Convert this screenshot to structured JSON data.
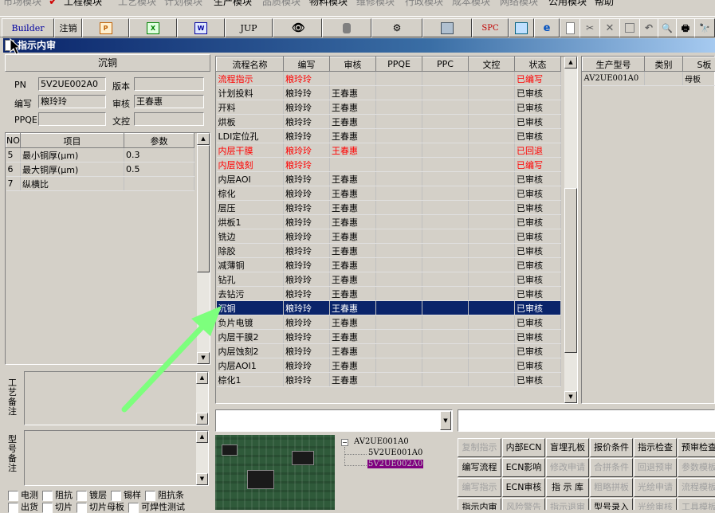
{
  "menu": {
    "items": [
      {
        "label": "市场模块",
        "active": false
      },
      {
        "label": "工程模块",
        "active": true
      },
      {
        "label": "工艺模块",
        "active": false
      },
      {
        "label": "计划模块",
        "active": false
      },
      {
        "label": "生产模块",
        "active": true
      },
      {
        "label": "品质模块",
        "active": false
      },
      {
        "label": "物料模块",
        "active": true
      },
      {
        "label": "维修模块",
        "active": false
      },
      {
        "label": "行政模块",
        "active": false
      },
      {
        "label": "成本模块",
        "active": false
      },
      {
        "label": "网络模块",
        "active": false
      },
      {
        "label": "公用模块",
        "active": true
      },
      {
        "label": "帮助",
        "active": true
      }
    ]
  },
  "toolbar": {
    "builder": "Builder",
    "logout": "注销",
    "jup": "JUP",
    "spc": "SPC",
    "icons": [
      "ppt-icon",
      "excel-icon",
      "word-icon",
      "eye-icon",
      "database-icon",
      "process-icon",
      "printer-device-icon",
      "copy-icon",
      "ie-icon",
      "new-doc-icon",
      "cut-icon",
      "delete-icon",
      "save-icon",
      "undo-icon",
      "preview-icon",
      "print-icon",
      "find-icon"
    ]
  },
  "window": {
    "title": "指示内审"
  },
  "left": {
    "header": "沉铜",
    "pn_label": "PN",
    "pn_value": "5V2UE002A0",
    "version_label": "版本",
    "version_value": "",
    "author_label": "编写",
    "author_value": "粮玲玲",
    "review_label": "审核",
    "review_value": "王春惠",
    "ppqe_label": "PPQE",
    "ppqe_value": "",
    "wenkong_label": "文控",
    "wenkong_value": "",
    "params_headers": {
      "no": "NO",
      "item": "项目",
      "value": "参数"
    },
    "params": [
      {
        "no": "5",
        "item": "最小铜厚(μm)",
        "value": "0.3"
      },
      {
        "no": "6",
        "item": "最大铜厚(μm)",
        "value": "0.5"
      },
      {
        "no": "7",
        "item": "纵横比",
        "value": ""
      }
    ],
    "process_note_label": "工艺备注",
    "model_note_label": "型号备注",
    "checkboxes_row1": [
      "电测",
      "阻抗",
      "镀层",
      "锡样",
      "阻抗条"
    ],
    "checkboxes_row2": [
      "出货",
      "切片",
      "切片母板",
      "可焊性测试"
    ]
  },
  "flow": {
    "headers": {
      "name": "流程名称",
      "author": "编写",
      "review": "审核",
      "ppqe": "PPQE",
      "ppc": "PPC",
      "wenkong": "文控",
      "status": "状态"
    },
    "rows": [
      {
        "name": "流程指示",
        "author": "粮玲玲",
        "review": "",
        "status": "已编写",
        "red": true
      },
      {
        "name": "计划投料",
        "author": "粮玲玲",
        "review": "王春惠",
        "status": "已审核",
        "red": false
      },
      {
        "name": "开料",
        "author": "粮玲玲",
        "review": "王春惠",
        "status": "已审核",
        "red": false
      },
      {
        "name": "烘板",
        "author": "粮玲玲",
        "review": "王春惠",
        "status": "已审核",
        "red": false
      },
      {
        "name": "LDI定位孔",
        "author": "粮玲玲",
        "review": "王春惠",
        "status": "已审核",
        "red": false
      },
      {
        "name": "内层干膜",
        "author": "粮玲玲",
        "review": "王春惠",
        "status": "已回退",
        "red": true
      },
      {
        "name": "内层蚀刻",
        "author": "粮玲玲",
        "review": "",
        "status": "已编写",
        "red": true
      },
      {
        "name": "内层AOI",
        "author": "粮玲玲",
        "review": "王春惠",
        "status": "已审核",
        "red": false
      },
      {
        "name": "棕化",
        "author": "粮玲玲",
        "review": "王春惠",
        "status": "已审核",
        "red": false
      },
      {
        "name": "层压",
        "author": "粮玲玲",
        "review": "王春惠",
        "status": "已审核",
        "red": false
      },
      {
        "name": "烘板1",
        "author": "粮玲玲",
        "review": "王春惠",
        "status": "已审核",
        "red": false
      },
      {
        "name": "铣边",
        "author": "粮玲玲",
        "review": "王春惠",
        "status": "已审核",
        "red": false
      },
      {
        "name": "除胶",
        "author": "粮玲玲",
        "review": "王春惠",
        "status": "已审核",
        "red": false
      },
      {
        "name": "减薄铜",
        "author": "粮玲玲",
        "review": "王春惠",
        "status": "已审核",
        "red": false
      },
      {
        "name": "钻孔",
        "author": "粮玲玲",
        "review": "王春惠",
        "status": "已审核",
        "red": false
      },
      {
        "name": "去钻污",
        "author": "粮玲玲",
        "review": "王春惠",
        "status": "已审核",
        "red": false
      },
      {
        "name": "沉铜",
        "author": "粮玲玲",
        "review": "王春惠",
        "status": "已审核",
        "red": false,
        "selected": true
      },
      {
        "name": "负片电镀",
        "author": "粮玲玲",
        "review": "王春惠",
        "status": "已审核",
        "red": false
      },
      {
        "name": "内层干膜2",
        "author": "粮玲玲",
        "review": "王春惠",
        "status": "已审核",
        "red": false
      },
      {
        "name": "内层蚀刻2",
        "author": "粮玲玲",
        "review": "王春惠",
        "status": "已审核",
        "red": false
      },
      {
        "name": "内层AOI1",
        "author": "粮玲玲",
        "review": "王春惠",
        "status": "已审核",
        "red": false
      },
      {
        "name": "棕化1",
        "author": "粮玲玲",
        "review": "王春惠",
        "status": "已审核",
        "red": false
      }
    ]
  },
  "models": {
    "headers": {
      "model": "生产型号",
      "category": "类别",
      "board": "S板"
    },
    "rows": [
      {
        "model": "AV2UE001A0",
        "category": "",
        "board": "母板"
      }
    ]
  },
  "tree": {
    "root": "AV2UE001A0",
    "children": [
      "5V2UE001A0",
      "5V2UE002A0"
    ]
  },
  "actions": [
    {
      "label": "复制指示",
      "disabled": true
    },
    {
      "label": "内部ECN",
      "disabled": false
    },
    {
      "label": "盲埋孔板",
      "disabled": false
    },
    {
      "label": "报价条件",
      "disabled": false
    },
    {
      "label": "指示检查",
      "disabled": false
    },
    {
      "label": "预审检查",
      "disabled": false
    },
    {
      "label": "编写流程",
      "disabled": false
    },
    {
      "label": "ECN影响",
      "disabled": false
    },
    {
      "label": "修改申请",
      "disabled": true
    },
    {
      "label": "合拼条件",
      "disabled": true
    },
    {
      "label": "回退预审",
      "disabled": true
    },
    {
      "label": "参数模板",
      "disabled": true
    },
    {
      "label": "编写指示",
      "disabled": true
    },
    {
      "label": "ECN审核",
      "disabled": false
    },
    {
      "label": "指 示 库",
      "disabled": false
    },
    {
      "label": "粗略拼板",
      "disabled": true
    },
    {
      "label": "光绘申请",
      "disabled": true
    },
    {
      "label": "流程模板",
      "disabled": true
    },
    {
      "label": "指示内审",
      "disabled": false
    },
    {
      "label": "风险警告",
      "disabled": true
    },
    {
      "label": "指示退审",
      "disabled": true
    },
    {
      "label": "型号录入",
      "disabled": false
    },
    {
      "label": "光绘审核",
      "disabled": true
    },
    {
      "label": "工具模板",
      "disabled": true
    }
  ],
  "colors": {
    "selection": "#0a246a",
    "title_start": "#0a246a",
    "title_end": "#a6caf0",
    "status_red": "#ff0000",
    "tree_highlight": "#800080",
    "arrow": "#7dff7d"
  }
}
